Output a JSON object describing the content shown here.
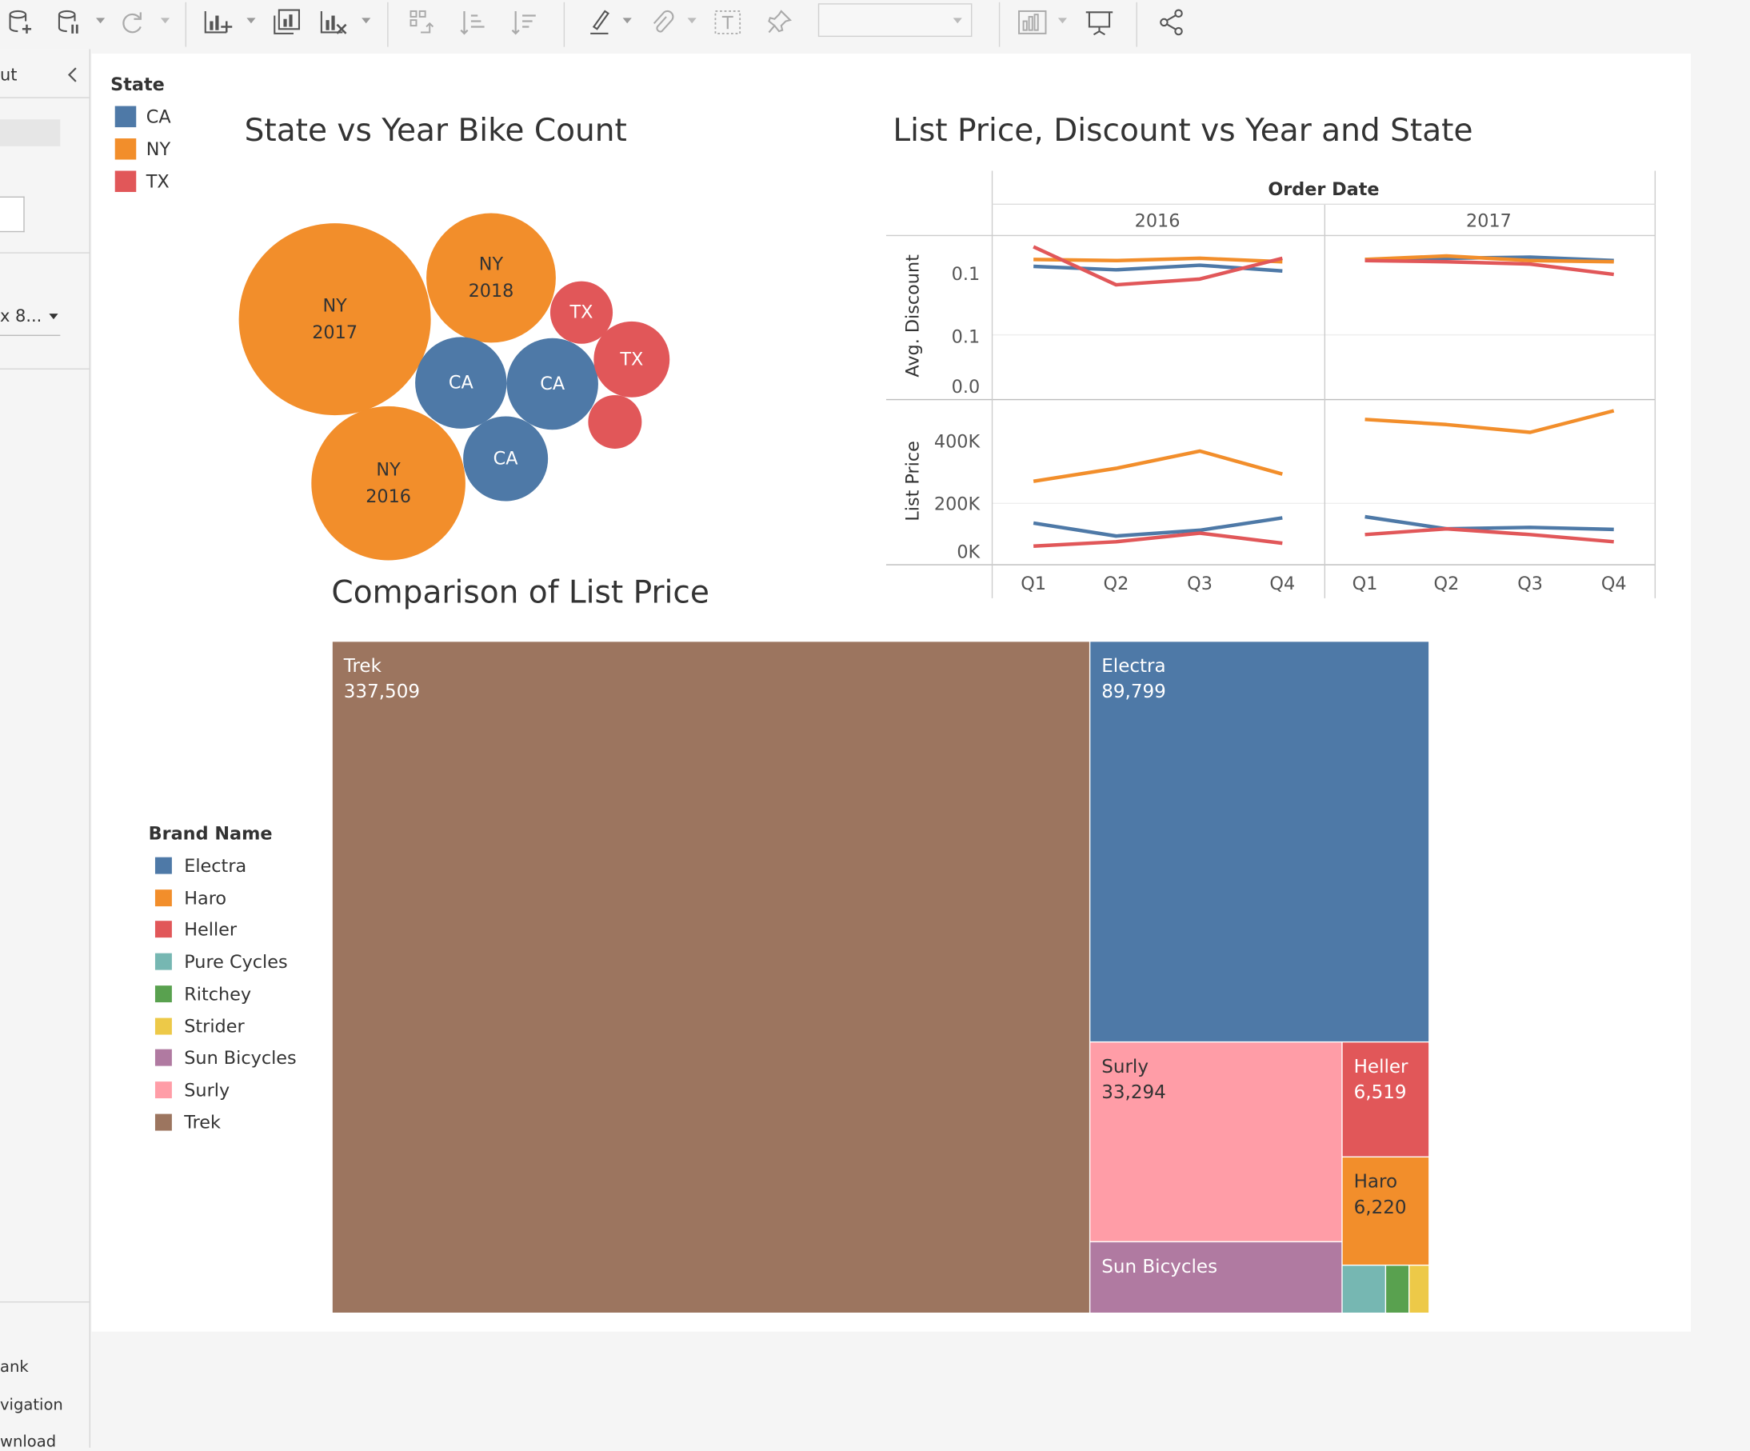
{
  "toolbar": {
    "icons": [
      "new-data-source-icon",
      "pause-updates-icon",
      "refresh-icon",
      "new-worksheet-icon",
      "duplicate-sheet-icon",
      "clear-sheet-icon",
      "swap-axes-icon",
      "sort-ascending-icon",
      "sort-descending-icon",
      "highlight-icon",
      "attach-icon",
      "text-label-icon",
      "pin-icon",
      "show-me-icon",
      "presentation-icon",
      "share-icon"
    ],
    "combo_value": ""
  },
  "left_pane": {
    "header": "ut",
    "size_value": "x 8...",
    "bottom_items": [
      "ank",
      "vigation",
      "wnload"
    ]
  },
  "bubble_chart": {
    "title": "State vs Year Bike Count",
    "legend_title": "State",
    "legend": [
      {
        "label": "CA",
        "color": "#4e79a7"
      },
      {
        "label": "NY",
        "color": "#f28e2b"
      },
      {
        "label": "TX",
        "color": "#e15759"
      }
    ],
    "bubbles": [
      {
        "state": "NY",
        "year": "2017",
        "line1": "NY",
        "line2": "2017",
        "color": "#f28e2b",
        "text": "#333"
      },
      {
        "state": "NY",
        "year": "2018",
        "line1": "NY",
        "line2": "2018",
        "color": "#f28e2b",
        "text": "#333"
      },
      {
        "state": "NY",
        "year": "2016",
        "line1": "NY",
        "line2": "2016",
        "color": "#f28e2b",
        "text": "#333"
      },
      {
        "state": "CA",
        "line1": "CA",
        "line2": "",
        "color": "#4e79a7",
        "text": "#ffffff"
      },
      {
        "state": "CA",
        "line1": "CA",
        "line2": "",
        "color": "#4e79a7",
        "text": "#ffffff"
      },
      {
        "state": "CA",
        "line1": "CA",
        "line2": "",
        "color": "#4e79a7",
        "text": "#ffffff"
      },
      {
        "state": "TX",
        "line1": "TX",
        "line2": "",
        "color": "#e15759",
        "text": "#ffffff"
      },
      {
        "state": "TX",
        "line1": "TX",
        "line2": "",
        "color": "#e15759",
        "text": "#ffffff"
      },
      {
        "state": "TX",
        "line1": "",
        "line2": "",
        "color": "#e15759",
        "text": "#ffffff"
      }
    ]
  },
  "line_chart": {
    "title": "List Price, Discount vs Year and State",
    "column_header": "Order Date",
    "years": [
      "2016",
      "2017"
    ],
    "quarters": [
      "Q1",
      "Q2",
      "Q3",
      "Q4"
    ],
    "discount_axis": {
      "label": "Avg. Discount",
      "ticks": [
        "0.1",
        "0.1",
        "0.0"
      ]
    },
    "price_axis": {
      "label": "List Price",
      "ticks": [
        "400K",
        "200K",
        "0K"
      ]
    }
  },
  "chart_data": {
    "type": "line",
    "x": [
      "2016 Q1",
      "2016 Q2",
      "2016 Q3",
      "2016 Q4",
      "2017 Q1",
      "2017 Q2",
      "2017 Q3",
      "2017 Q4"
    ],
    "series": [
      {
        "name": "CA",
        "color": "#4e79a7",
        "discount": [
          0.101,
          0.098,
          0.102,
          0.097,
          0.107,
          0.108,
          0.109,
          0.106
        ],
        "list_price": [
          110000,
          65000,
          85000,
          128000,
          132000,
          90000,
          95000,
          88000
        ]
      },
      {
        "name": "NY",
        "color": "#f28e2b",
        "discount": [
          0.107,
          0.106,
          0.108,
          0.105,
          0.107,
          0.11,
          0.106,
          0.105
        ],
        "list_price": [
          255000,
          300000,
          360000,
          280000,
          470000,
          452000,
          425000,
          500000
        ]
      },
      {
        "name": "TX",
        "color": "#e15759",
        "discount": [
          0.118,
          0.085,
          0.09,
          0.108,
          0.106,
          0.105,
          0.103,
          0.094
        ],
        "list_price": [
          30000,
          45000,
          75000,
          40000,
          70000,
          90000,
          70000,
          45000
        ]
      }
    ],
    "discount_range": [
      0.0,
      0.12
    ],
    "price_range": [
      0,
      500000
    ]
  },
  "treemap": {
    "title": "Comparison of List Price",
    "legend_title": "Brand Name",
    "legend": [
      {
        "label": "Electra",
        "color": "#4e79a7"
      },
      {
        "label": "Haro",
        "color": "#f28e2b"
      },
      {
        "label": "Heller",
        "color": "#e15759"
      },
      {
        "label": "Pure Cycles",
        "color": "#76b7b2"
      },
      {
        "label": "Ritchey",
        "color": "#59a14f"
      },
      {
        "label": "Strider",
        "color": "#edc948"
      },
      {
        "label": "Sun Bicycles",
        "color": "#b07aa1"
      },
      {
        "label": "Surly",
        "color": "#ff9da7"
      },
      {
        "label": "Trek",
        "color": "#9c755f"
      }
    ],
    "cells": [
      {
        "name": "Trek",
        "value": "337,509",
        "color": "#9c755f",
        "text": "#ffffff"
      },
      {
        "name": "Electra",
        "value": "89,799",
        "color": "#4e79a7",
        "text": "#ffffff"
      },
      {
        "name": "Surly",
        "value": "33,294",
        "color": "#ff9da7",
        "text": "#333333"
      },
      {
        "name": "Heller",
        "value": "6,519",
        "color": "#e15759",
        "text": "#ffffff"
      },
      {
        "name": "Haro",
        "value": "6,220",
        "color": "#f28e2b",
        "text": "#333333"
      },
      {
        "name": "Sun Bicycles",
        "value": "",
        "color": "#b07aa1",
        "text": "#ffffff"
      },
      {
        "name": "",
        "value": "",
        "color": "#76b7b2",
        "text": "#ffffff"
      },
      {
        "name": "",
        "value": "",
        "color": "#59a14f",
        "text": "#ffffff"
      },
      {
        "name": "",
        "value": "",
        "color": "#edc948",
        "text": "#ffffff"
      }
    ]
  }
}
